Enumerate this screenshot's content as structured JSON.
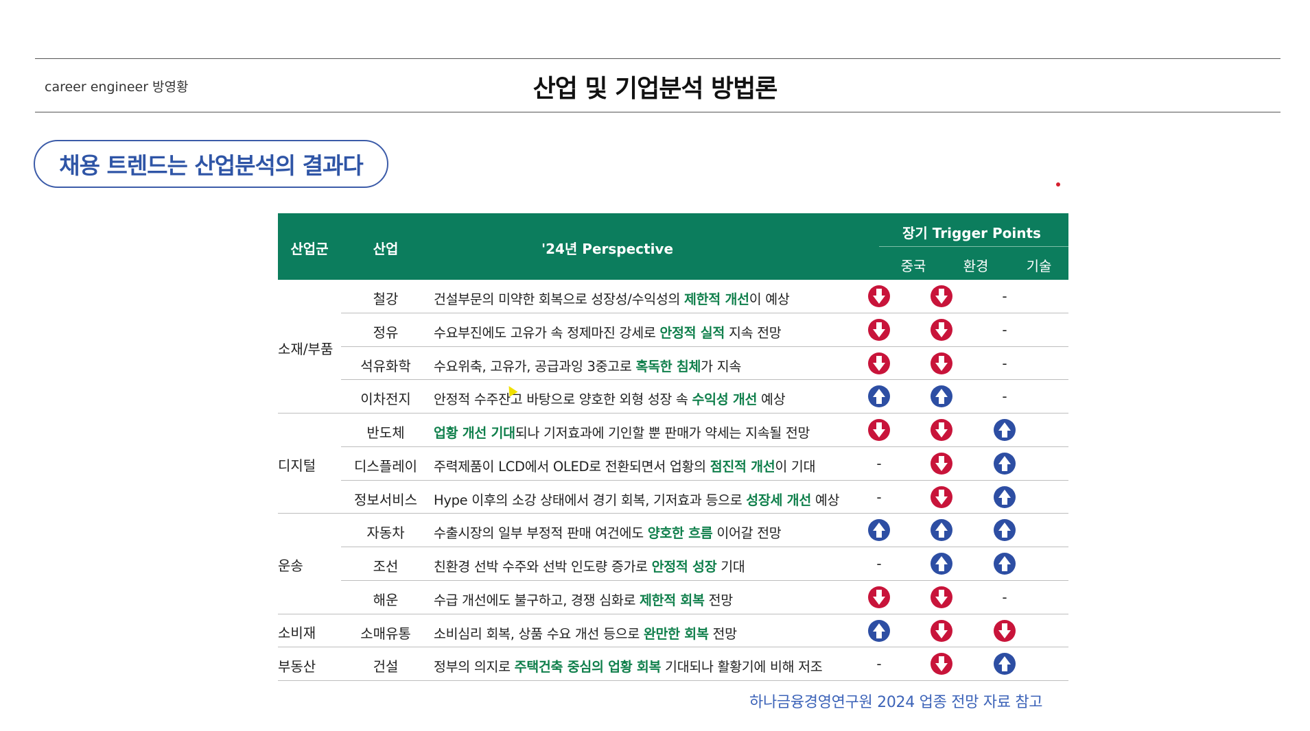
{
  "header": {
    "author": "career engineer 방영황",
    "title": "산업 및 기업분석 방법론"
  },
  "section_label": "채용 트렌드는 산업분석의 결과다",
  "table": {
    "columns": {
      "group": "산업군",
      "industry": "산업",
      "perspective": "'24년 Perspective",
      "trigger_title": "장기 Trigger Points",
      "trigger_sub": [
        "중국",
        "환경",
        "기술"
      ]
    },
    "groups": [
      {
        "label": "소재/부품",
        "rows": [
          0,
          1,
          2,
          3
        ]
      },
      {
        "label": "디지털",
        "rows": [
          4,
          5,
          6
        ]
      },
      {
        "label": "운송",
        "rows": [
          7,
          8,
          9
        ]
      },
      {
        "label": "소비재",
        "rows": [
          10
        ]
      },
      {
        "label": "부동산",
        "rows": [
          11
        ]
      }
    ],
    "rows": [
      {
        "industry": "철강",
        "parts": [
          [
            "건설부문의 미약한 회복으로 성장성/수익성의 ",
            false
          ],
          [
            "제한적 개선",
            true
          ],
          [
            "이 예상",
            false
          ]
        ],
        "china": "down",
        "env": "down",
        "tech": "-"
      },
      {
        "industry": "정유",
        "parts": [
          [
            "수요부진에도 고유가 속 정제마진 강세로 ",
            false
          ],
          [
            "안정적 실적",
            true
          ],
          [
            " 지속 전망",
            false
          ]
        ],
        "china": "down",
        "env": "down",
        "tech": "-"
      },
      {
        "industry": "석유화학",
        "parts": [
          [
            "수요위축, 고유가, 공급과잉 3중고로 ",
            false
          ],
          [
            "혹독한 침체",
            true
          ],
          [
            "가 지속",
            false
          ]
        ],
        "china": "down",
        "env": "down",
        "tech": "-"
      },
      {
        "industry": "이차전지",
        "parts": [
          [
            "안정적 수주잔고 바탕으로 양호한 외형 성장 속 ",
            false
          ],
          [
            "수익성 개선",
            true
          ],
          [
            " 예상",
            false
          ]
        ],
        "china": "up",
        "env": "up",
        "tech": "-"
      },
      {
        "industry": "반도체",
        "parts": [
          [
            "업황 개선 기대",
            true
          ],
          [
            "되나 기저효과에 기인할 뿐 판매가 약세는 지속될 전망",
            false
          ]
        ],
        "china": "down",
        "env": "down",
        "tech": "up"
      },
      {
        "industry": "디스플레이",
        "parts": [
          [
            "주력제품이 LCD에서 OLED로 전환되면서 업황의 ",
            false
          ],
          [
            "점진적 개선",
            true
          ],
          [
            "이 기대",
            false
          ]
        ],
        "china": "-",
        "env": "down",
        "tech": "up"
      },
      {
        "industry": "정보서비스",
        "parts": [
          [
            "Hype 이후의 소강 상태에서 경기 회복, 기저효과 등으로 ",
            false
          ],
          [
            "성장세 개선",
            true
          ],
          [
            " 예상",
            false
          ]
        ],
        "china": "-",
        "env": "down",
        "tech": "up"
      },
      {
        "industry": "자동차",
        "parts": [
          [
            "수출시장의 일부 부정적 판매 여건에도 ",
            false
          ],
          [
            "양호한 흐름",
            true
          ],
          [
            " 이어갈 전망",
            false
          ]
        ],
        "china": "up",
        "env": "up",
        "tech": "up"
      },
      {
        "industry": "조선",
        "parts": [
          [
            "친환경 선박 수주와 선박 인도량 증가로 ",
            false
          ],
          [
            "안정적 성장",
            true
          ],
          [
            " 기대",
            false
          ]
        ],
        "china": "-",
        "env": "up",
        "tech": "up"
      },
      {
        "industry": "해운",
        "parts": [
          [
            "수급 개선에도 불구하고, 경쟁 심화로 ",
            false
          ],
          [
            "제한적 회복",
            true
          ],
          [
            " 전망",
            false
          ]
        ],
        "china": "down",
        "env": "down",
        "tech": "-"
      },
      {
        "industry": "소매유통",
        "parts": [
          [
            "소비심리 회복, 상품 수요 개선 등으로 ",
            false
          ],
          [
            "완만한 회복",
            true
          ],
          [
            " 전망",
            false
          ]
        ],
        "china": "up",
        "env": "down",
        "tech": "down"
      },
      {
        "industry": "건설",
        "parts": [
          [
            "정부의 의지로 ",
            false
          ],
          [
            "주택건축 중심의 업황 회복",
            true
          ],
          [
            " 기대되나 활황기에 비해 저조",
            false
          ]
        ],
        "china": "-",
        "env": "down",
        "tech": "up"
      }
    ]
  },
  "source_note": "하나금융경영연구원 2024 업종 전망 자료 참고",
  "icons": {
    "down": "down-arrow-icon",
    "up": "up-arrow-icon",
    "none": "-"
  },
  "colors": {
    "header_green": "#0c7d5d",
    "highlight_green": "#0f7f4b",
    "down_red": "#c8143a",
    "up_blue": "#2d4ea3",
    "pill_blue": "#2f55a6",
    "source_blue": "#3c63b8"
  }
}
